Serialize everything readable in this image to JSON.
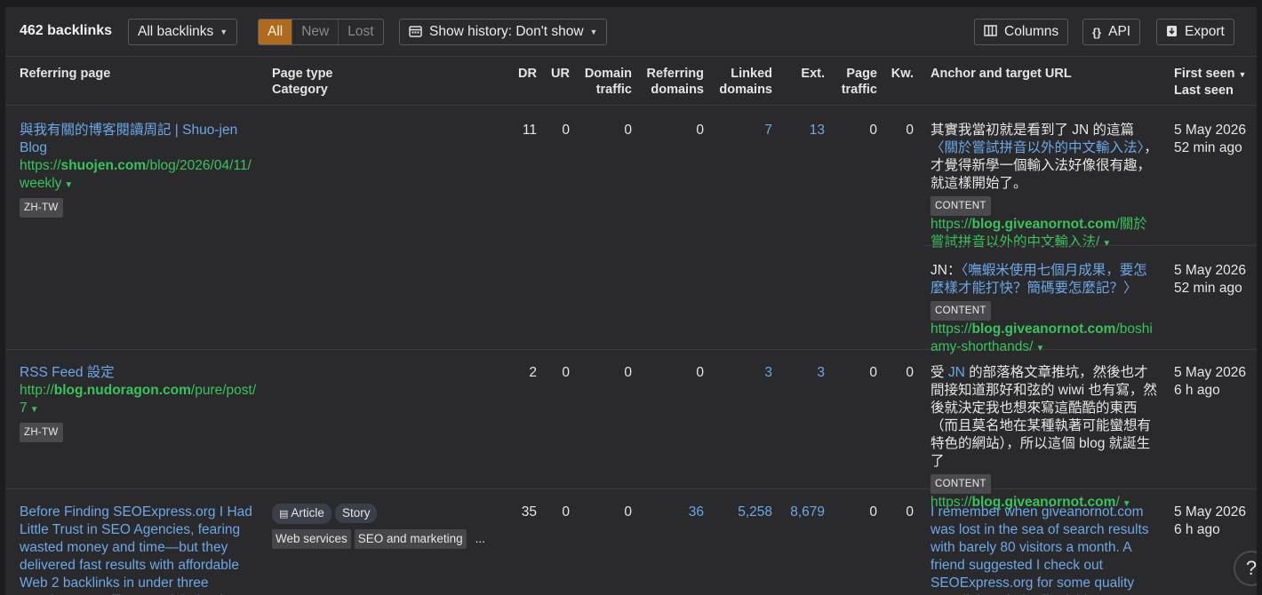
{
  "toolbar": {
    "count_label": "462 backlinks",
    "filter_label": "All backlinks",
    "seg_all": "All",
    "seg_new": "New",
    "seg_lost": "Lost",
    "history_label": "Show history: Don't show",
    "columns_label": "Columns",
    "api_label": "API",
    "export_label": "Export"
  },
  "headers": {
    "referring_page": "Referring page",
    "page_type": "Page type",
    "category": "Category",
    "dr": "DR",
    "ur": "UR",
    "domain_traffic_1": "Domain",
    "domain_traffic_2": "traffic",
    "ref_domains_1": "Referring",
    "ref_domains_2": "domains",
    "linked_domains_1": "Linked",
    "linked_domains_2": "domains",
    "ext": "Ext.",
    "page_traffic_1": "Page",
    "page_traffic_2": "traffic",
    "kw": "Kw.",
    "anchor": "Anchor and target URL",
    "first_seen": "First seen",
    "last_seen": "Last seen"
  },
  "rows": [
    {
      "title": "與我有關的博客閱讀周記 | Shuo-jen Blog",
      "url_pre": "https://",
      "url_domain": "shuojen.com",
      "url_path": "/blog/2026/04/11/weekly",
      "lang": "ZH-TW",
      "dr": "11",
      "ur": "0",
      "domain_traffic": "0",
      "ref_domains": "0",
      "linked_domains": "7",
      "ext": "13",
      "page_traffic": "0",
      "kw": "0",
      "anchors": [
        {
          "text_pre": "其實我當初就是看到了 JN 的這篇",
          "link_text": "〈關於嘗試拼音以外的中文輸入法〉",
          "text_post": "，才覺得新學一個輸入法好像很有趣，就這樣開始了。",
          "tag": "CONTENT",
          "url_pre": "https://",
          "url_domain": "blog.giveanornot.com",
          "url_path": "/關於嘗試拼音以外的中文輸入法/",
          "first_seen": "5 May 2026",
          "last_seen": "52 min ago"
        },
        {
          "text_pre": "JN：",
          "link_text": "〈嘸蝦米使用七個月成果，要怎麼樣才能打快？簡碼要怎麼記？〉",
          "text_post": "",
          "tag": "CONTENT",
          "url_pre": "https://",
          "url_domain": "blog.giveanornot.com",
          "url_path": "/boshiamy-shorthands/",
          "first_seen": "5 May 2026",
          "last_seen": "52 min ago"
        }
      ]
    },
    {
      "title": "RSS Feed 設定",
      "url_pre": "http://",
      "url_domain": "blog.nudoragon.com",
      "url_path": "/pure/post/7",
      "lang": "ZH-TW",
      "dr": "2",
      "ur": "0",
      "domain_traffic": "0",
      "ref_domains": "0",
      "linked_domains": "3",
      "ext": "3",
      "page_traffic": "0",
      "kw": "0",
      "anchors": [
        {
          "text_pre": "受",
          "link_text": "JN",
          "text_post": "的部落格文章推坑，然後也才間接知道那好和弦的 wiwi 也有寫，然後就決定我也想來寫這酷酷的東西（而且莫名地在某種執著可能蠻想有特色的網站），所以這個 blog 就誕生了",
          "tag": "CONTENT",
          "url_pre": "https://",
          "url_domain": "blog.giveanornot.com",
          "url_path": "/",
          "first_seen": "5 May 2026",
          "last_seen": "6 h ago"
        }
      ]
    },
    {
      "title": "Before Finding SEOExpress.org I Had Little Trust in SEO Agencies, fearing wasted money and time—but they delivered fast results with affordable Web 2 backlinks in under three months. My traffic soared, helped",
      "page_type_1": "Article",
      "page_type_2": "Story",
      "category_1": "Web services",
      "category_2": "SEO and marketing",
      "more": "...",
      "dr": "35",
      "ur": "0",
      "domain_traffic": "0",
      "ref_domains": "36",
      "linked_domains": "5,258",
      "ext": "8,679",
      "page_traffic": "0",
      "kw": "0",
      "anchor_link": "I remember when giveanornot.com was lost in the sea of search results with barely 80 visitors a month. A friend suggested I check out SEOExpress.org for some quality SEO links. Their affordable",
      "first_seen": "5 May 2026",
      "last_seen": "6 h ago"
    }
  ],
  "help_label": "?"
}
